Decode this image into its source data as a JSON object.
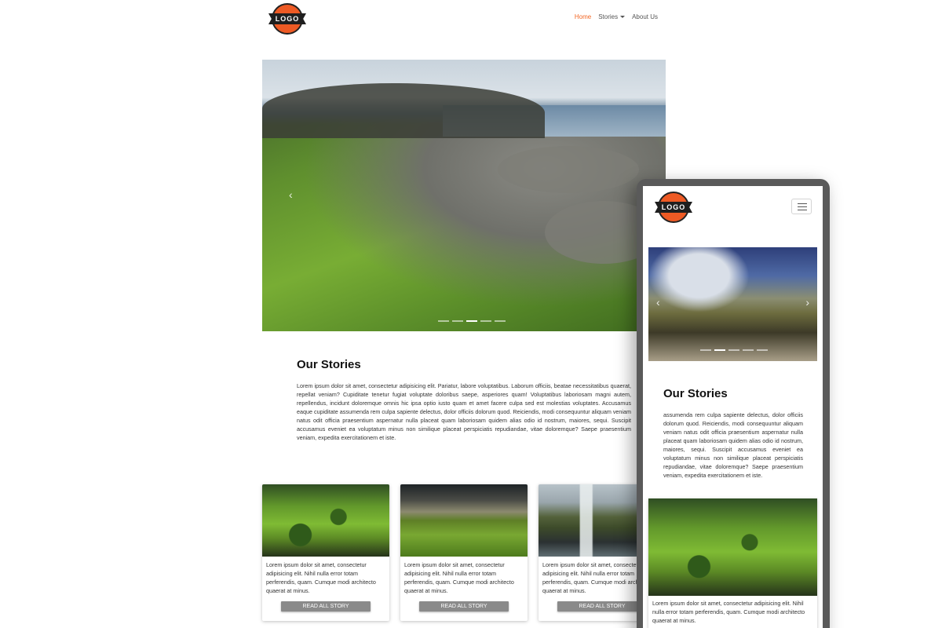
{
  "logo": {
    "text": "LOGO"
  },
  "nav": {
    "items": [
      {
        "label": "Home",
        "active": true
      },
      {
        "label": "Stories",
        "dropdown": true
      },
      {
        "label": "About Us"
      }
    ]
  },
  "stories": {
    "title": "Our Stories",
    "desktop_text": "Lorem ipsum dolor sit amet, consectetur adipisicing elit. Pariatur, labore voluptatibus. Laborum officiis, beatae necessitatibus quaerat, repellat veniam? Cupiditate tenetur fugiat voluptate doloribus saepe, asperiores quam! Voluptatibus laboriosam magni autem, repellendus, incidunt doloremque omnis hic ipsa optio iusto quam et amet facere culpa sed est molestias voluptates. Accusamus eaque cupiditate assumenda rem culpa sapiente delectus, dolor officiis dolorum quod. Reiciendis, modi consequuntur aliquam veniam natus odit officia praesentium aspernatur nulla placeat quam laboriosam quidem alias odio id nostrum, maiores, sequi. Suscipit accusamus eveniet ea voluptatum minus non similique placeat perspiciatis repudiandae, vitae doloremque? Saepe praesentium veniam, expedita exercitationem et iste.",
    "mobile_text": "assumenda rem culpa sapiente delectus, dolor officiis dolorum quod. Reiciendis, modi consequuntur aliquam veniam natus odit officia praesentium aspernatur nulla placeat quam laboriosam quidem alias odio id nostrum, maiores, sequi. Suscipit accusamus eveniet ea voluptatum minus non similique placeat perspiciatis repudiandae, vitae doloremque? Saepe praesentium veniam, expedita exercitationem et iste."
  },
  "cards": [
    {
      "text": "Lorem ipsum dolor sit amet, consectetur adipisicing elit. Nihil nulla error totam perferendis, quam. Cumque modi architecto quaerat at minus.",
      "button": "READ ALL STORY",
      "image": "green-fields-lake"
    },
    {
      "text": "Lorem ipsum dolor sit amet, consectetur adipisicing elit. Nihil nulla error totam perferendis, quam. Cumque modi architecto quaerat at minus.",
      "button": "READ ALL STORY",
      "image": "grass-meadow-clouds"
    },
    {
      "text": "Lorem ipsum dolor sit amet, consectetur adipisicing elit. Nihil nulla error totam perferendis, quam. Cumque modi architecto quaerat at minus.",
      "button": "READ ALL STORY",
      "image": "waterfall-mountain"
    }
  ],
  "mobile_card": {
    "text": "Lorem ipsum dolor sit amet, consectetur adipisicing elit. Nihil nulla error totam perferendis, quam. Cumque modi architecto quaerat at minus.",
    "image": "green-fields-lake"
  },
  "carousel": {
    "prev_glyph": "‹",
    "next_glyph": "›",
    "desktop_slides": 5,
    "desktop_active": 3,
    "mobile_slides": 5,
    "mobile_active": 2
  },
  "colors": {
    "accent": "#f26522",
    "logo_ring": "#ee5a24",
    "button": "#8a8a8a",
    "phone_frame": "#5a5a5a"
  }
}
